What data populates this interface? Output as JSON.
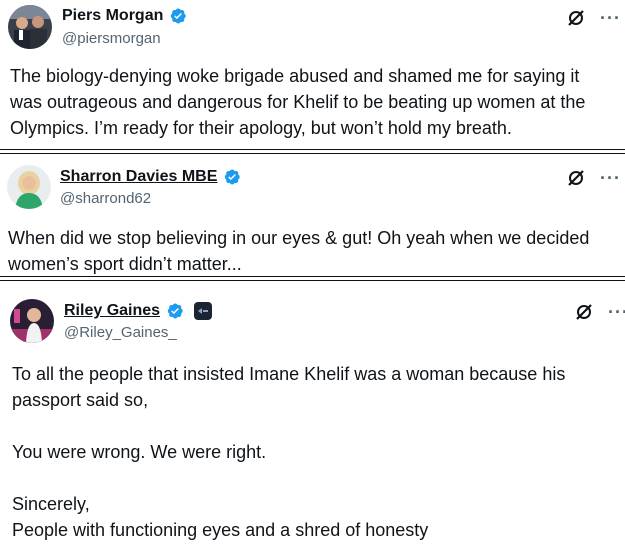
{
  "tweets": [
    {
      "name": "Piers Morgan",
      "handle": "@piersmorgan",
      "text": "The biology-denying woke brigade abused and shamed me for saying it\nwas outrageous and dangerous for Khelif to be beating up women at the\nOlympics. I’m ready for their apology, but won’t hold my breath."
    },
    {
      "name": "Sharron Davies MBE",
      "handle": "@sharrond62",
      "text": "When did we stop believing in our eyes & gut! Oh yeah when we decided\nwomen’s sport didn’t matter..."
    },
    {
      "name": "Riley Gaines",
      "handle": "@Riley_Gaines_",
      "text": "To all the people that insisted Imane Khelif was a woman because his\npassport said so,\n\nYou were wrong. We were right.\n\nSincerely,\nPeople with functioning eyes and a shred of honesty"
    }
  ],
  "icons": {
    "verified": "verified-badge-icon",
    "grok": "grok-icon",
    "more": "more-options-icon",
    "affiliate": "affiliate-badge-icon"
  },
  "colors": {
    "verified": "#1d9bf0",
    "text": "#0f1419",
    "secondary": "#536471"
  }
}
